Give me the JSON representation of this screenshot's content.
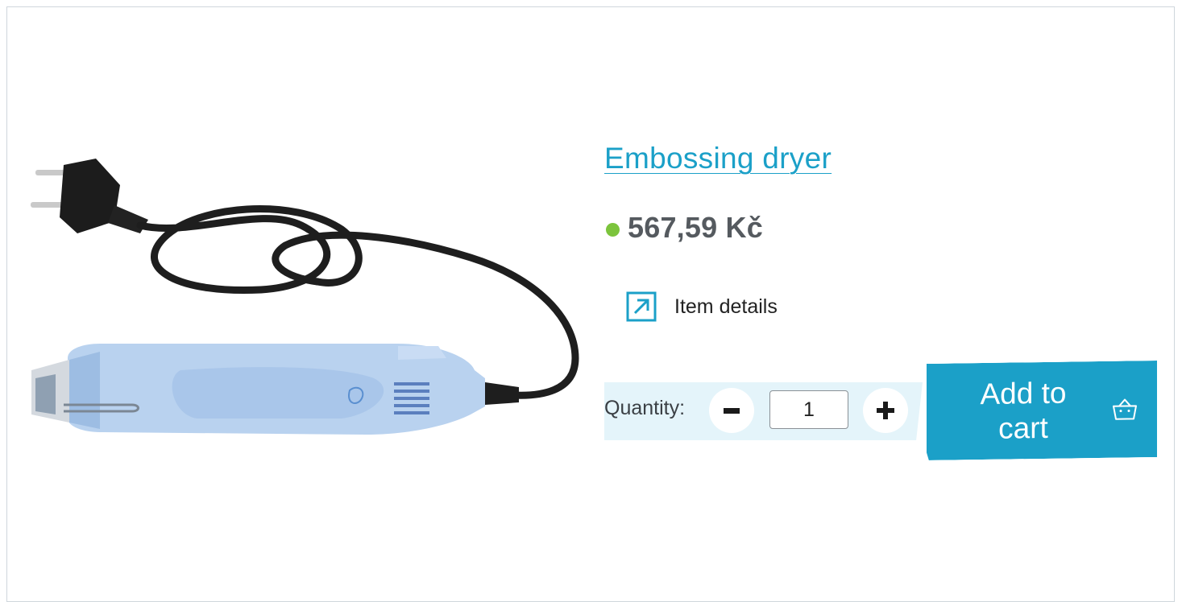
{
  "product": {
    "title": "Embossing dryer",
    "price": "567,59 Kč",
    "stock_color": "#7cc43c",
    "image_alt": "embossing-heat-gun"
  },
  "details": {
    "label": "Item details",
    "icon": "external-link-icon"
  },
  "quantity": {
    "label": "Quantity:",
    "value": "1",
    "minus_icon": "minus-icon",
    "plus_icon": "plus-icon"
  },
  "cart": {
    "label": "Add to cart",
    "icon": "basket-icon"
  },
  "colors": {
    "accent": "#1ba0c8",
    "qty_band": "#e4f4fa"
  }
}
